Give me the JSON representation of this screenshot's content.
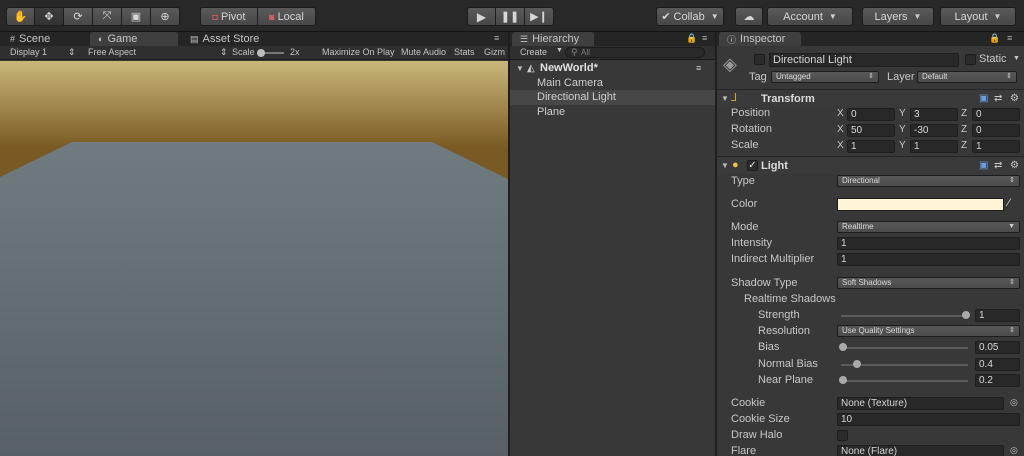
{
  "toolbar": {
    "transform_tools": [
      "hand-tool",
      "move-tool",
      "rotate-tool",
      "scale-tool",
      "rect-tool",
      "transform-tool"
    ],
    "pivot_label": "Pivot",
    "local_label": "Local",
    "play_controls": [
      "play",
      "pause",
      "step"
    ],
    "collab_label": "Collab",
    "account_label": "Account",
    "layers_label": "Layers",
    "layout_label": "Layout"
  },
  "game_panel": {
    "tabs": [
      {
        "label": "Scene",
        "icon": "grid-icon"
      },
      {
        "label": "Game",
        "icon": "pacman-icon"
      },
      {
        "label": "Asset Store",
        "icon": "bag-icon"
      }
    ],
    "display": "Display 1",
    "aspect": "Free Aspect",
    "scale_label": "Scale",
    "scale_value": "2x",
    "options": [
      "Maximize On Play",
      "Mute Audio",
      "Stats",
      "Gizm"
    ],
    "colors": {
      "sky_top": "#c9b77a",
      "sky_bottom": "#6b4f22",
      "plane_top": "#707b7f",
      "plane_bottom": "#576165"
    }
  },
  "hierarchy": {
    "tab_label": "Hierarchy",
    "create_label": "Create",
    "search_placeholder": "All",
    "scene_name": "NewWorld*",
    "items": [
      "Main Camera",
      "Directional Light",
      "Plane"
    ],
    "selected": "Directional Light"
  },
  "inspector": {
    "tab_label": "Inspector",
    "object_name": "Directional Light",
    "static_label": "Static",
    "tag_label": "Tag",
    "tag_value": "Untagged",
    "layer_label": "Layer",
    "layer_value": "Default",
    "transform": {
      "title": "Transform",
      "position_label": "Position",
      "rotation_label": "Rotation",
      "scale_label": "Scale",
      "axis_x": "X",
      "axis_y": "Y",
      "axis_z": "Z",
      "position": [
        "0",
        "3",
        "0"
      ],
      "rotation": [
        "50",
        "-30",
        "0"
      ],
      "scale": [
        "1",
        "1",
        "1"
      ]
    },
    "light": {
      "title": "Light",
      "type_label": "Type",
      "type_value": "Directional",
      "color_label": "Color",
      "color_value": "#fff4d6",
      "mode_label": "Mode",
      "mode_value": "Realtime",
      "intensity_label": "Intensity",
      "intensity_value": "1",
      "indirect_label": "Indirect Multiplier",
      "indirect_value": "1",
      "shadow_type_label": "Shadow Type",
      "shadow_type_value": "Soft Shadows",
      "realtime_shadows_label": "Realtime Shadows",
      "strength_label": "Strength",
      "strength_value": "1",
      "resolution_label": "Resolution",
      "resolution_value": "Use Quality Settings",
      "bias_label": "Bias",
      "bias_value": "0.05",
      "normal_bias_label": "Normal Bias",
      "normal_bias_value": "0.4",
      "near_plane_label": "Near Plane",
      "near_plane_value": "0.2",
      "cookie_label": "Cookie",
      "cookie_value": "None (Texture)",
      "cookie_size_label": "Cookie Size",
      "cookie_size_value": "10",
      "draw_halo_label": "Draw Halo",
      "flare_label": "Flare",
      "flare_value": "None (Flare)"
    }
  }
}
